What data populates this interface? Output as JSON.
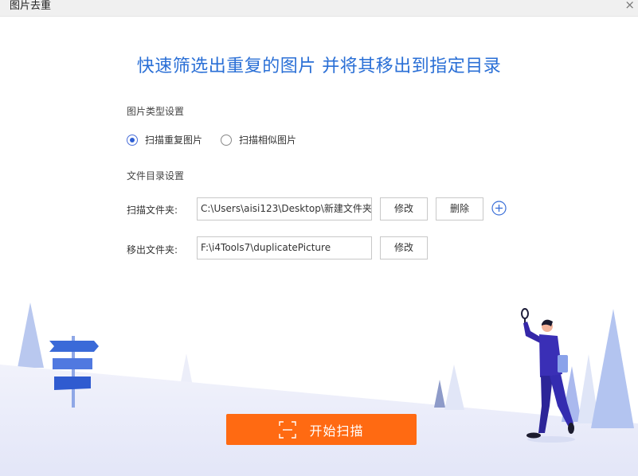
{
  "window": {
    "title": "图片去重",
    "close_glyph": "×"
  },
  "headline": "快速筛选出重复的图片 并将其移出到指定目录",
  "image_type": {
    "section_label": "图片类型设置",
    "options": [
      {
        "label": "扫描重复图片",
        "checked": true
      },
      {
        "label": "扫描相似图片",
        "checked": false
      }
    ]
  },
  "directory": {
    "section_label": "文件目录设置",
    "scan_folder": {
      "label": "扫描文件夹:",
      "value": "C:\\Users\\aisi123\\Desktop\\新建文件夹",
      "modify_label": "修改",
      "delete_label": "删除"
    },
    "move_folder": {
      "label": "移出文件夹:",
      "value": "F:\\i4Tools7\\duplicatePicture",
      "modify_label": "修改"
    }
  },
  "start_button": {
    "label": "开始扫描"
  },
  "icons": {
    "add": "plus-circle-icon",
    "scan": "scan-frame-icon",
    "close": "close-icon"
  },
  "colors": {
    "accent_blue": "#2a6fd6",
    "start_orange": "#ff6a12",
    "radio_blue": "#2e5fd3"
  }
}
